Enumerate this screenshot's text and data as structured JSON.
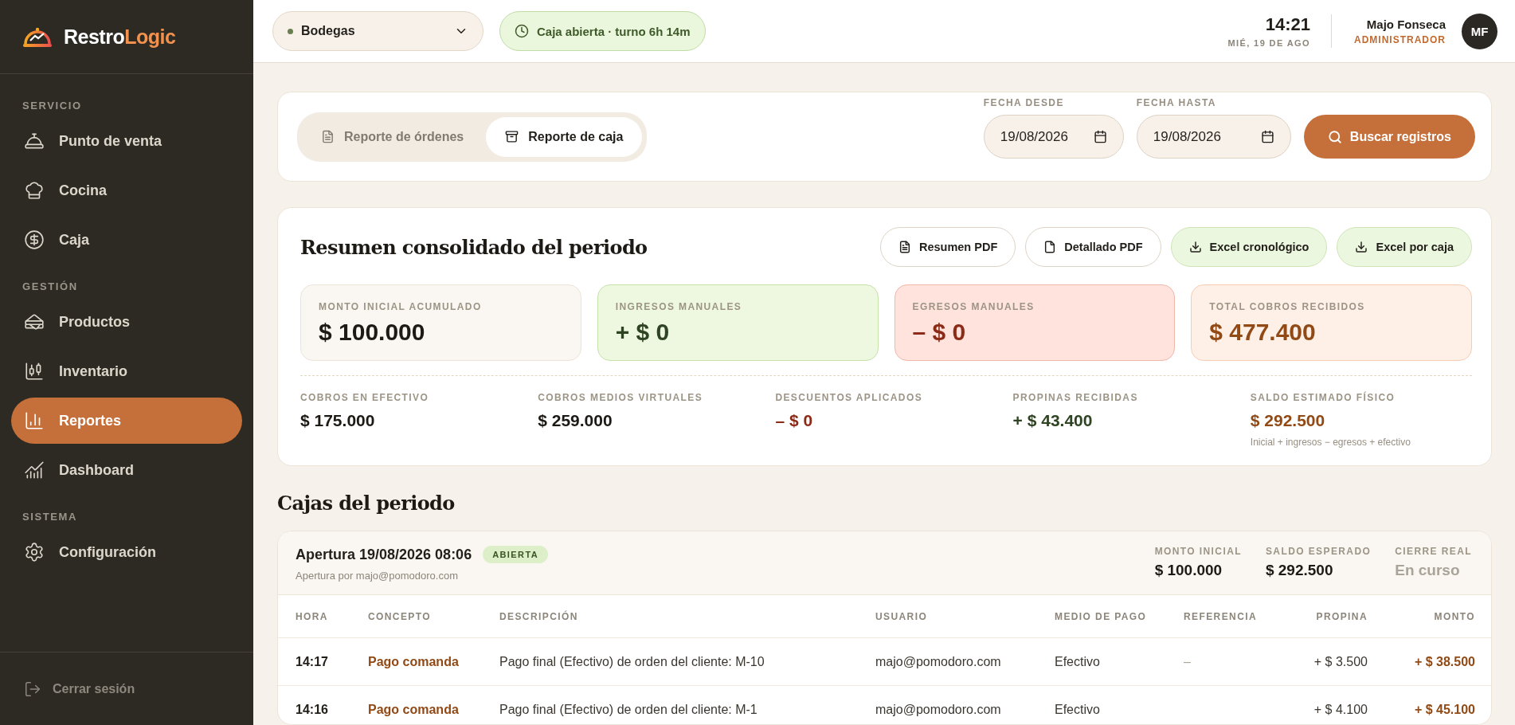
{
  "brand": {
    "name_main": "Restro",
    "name_accent": "Logic"
  },
  "sidebar": {
    "sections": [
      {
        "title": "SERVICIO",
        "items": [
          {
            "label": "Punto de venta",
            "selected": false
          },
          {
            "label": "Cocina",
            "selected": false
          },
          {
            "label": "Caja",
            "selected": false
          }
        ]
      },
      {
        "title": "GESTIÓN",
        "items": [
          {
            "label": "Productos",
            "selected": false
          },
          {
            "label": "Inventario",
            "selected": false
          },
          {
            "label": "Reportes",
            "selected": true
          },
          {
            "label": "Dashboard",
            "selected": false
          }
        ]
      },
      {
        "title": "SISTEMA",
        "items": [
          {
            "label": "Configuración",
            "selected": false
          }
        ]
      }
    ],
    "logout": "Cerrar sesión"
  },
  "topbar": {
    "branch_select": {
      "value": "Bodegas"
    },
    "shift_badge": "Caja abierta · turno 6h 14m",
    "time": "14:21",
    "date": "MIÉ, 19 DE AGO",
    "user": {
      "name": "Majo Fonseca",
      "role": "ADMINISTRADOR",
      "initials": "MF"
    }
  },
  "report_tabs": [
    {
      "label": "Reporte de órdenes",
      "selected": false
    },
    {
      "label": "Reporte de caja",
      "selected": true
    }
  ],
  "date_from": {
    "label": "FECHA DESDE",
    "value": "19/08/2026"
  },
  "date_to": {
    "label": "FECHA HASTA",
    "value": "19/08/2026"
  },
  "search_button": "Buscar registros",
  "summary": {
    "title": "Resumen consolidado del periodo",
    "actions": [
      {
        "label": "Resumen PDF",
        "kind": "pdf"
      },
      {
        "label": "Detallado PDF",
        "kind": "detail"
      },
      {
        "label": "Excel cronológico",
        "kind": "excel"
      },
      {
        "label": "Excel por caja",
        "kind": "excel"
      }
    ],
    "cards": [
      {
        "label": "MONTO INICIAL ACUMULADO",
        "value": "$ 100.000",
        "kind": "neutral"
      },
      {
        "label": "INGRESOS MANUALES",
        "value": "+ $ 0",
        "kind": "positive"
      },
      {
        "label": "EGRESOS MANUALES",
        "value": "– $ 0",
        "kind": "negative"
      },
      {
        "label": "TOTAL COBROS RECIBIDOS",
        "value": "$ 477.400",
        "kind": "accent"
      }
    ],
    "stats": [
      {
        "label": "COBROS EN EFECTIVO",
        "value": "$ 175.000",
        "kind": "neutral"
      },
      {
        "label": "COBROS MEDIOS VIRTUALES",
        "value": "$ 259.000",
        "kind": "neutral"
      },
      {
        "label": "DESCUENTOS APLICADOS",
        "value": "– $ 0",
        "kind": "negative"
      },
      {
        "label": "PROPINAS RECIBIDAS",
        "value": "+ $ 43.400",
        "kind": "positive"
      },
      {
        "label": "SALDO ESTIMADO FÍSICO",
        "value": "$ 292.500",
        "kind": "accent",
        "note": "Inicial + ingresos − egresos + efectivo"
      }
    ]
  },
  "cajas": {
    "title": "Cajas del periodo",
    "sessions": [
      {
        "title": "Apertura 19/08/2026 08:06",
        "status": "ABIERTA",
        "opened_by": "Apertura por majo@pomodoro.com",
        "metrics": [
          {
            "label": "MONTO INICIAL",
            "value": "$ 100.000",
            "kind": "neutral"
          },
          {
            "label": "SALDO ESPERADO",
            "value": "$ 292.500",
            "kind": "neutral"
          },
          {
            "label": "CIERRE REAL",
            "value": "En curso",
            "kind": "muted"
          }
        ],
        "columns": [
          "HORA",
          "CONCEPTO",
          "DESCRIPCIÓN",
          "USUARIO",
          "MEDIO DE PAGO",
          "REFERENCIA",
          "PROPINA",
          "MONTO"
        ],
        "rows": [
          [
            "14:17",
            "Pago comanda",
            "Pago final (Efectivo) de orden del cliente: M-10",
            "majo@pomodoro.com",
            "Efectivo",
            "–",
            "+ $ 3.500",
            "+ $ 38.500"
          ],
          [
            "14:16",
            "Pago comanda",
            "Pago final (Efectivo) de orden del cliente: M-1",
            "majo@pomodoro.com",
            "Efectivo",
            "",
            "+ $ 4.100",
            "+ $ 45.100"
          ]
        ]
      }
    ]
  }
}
